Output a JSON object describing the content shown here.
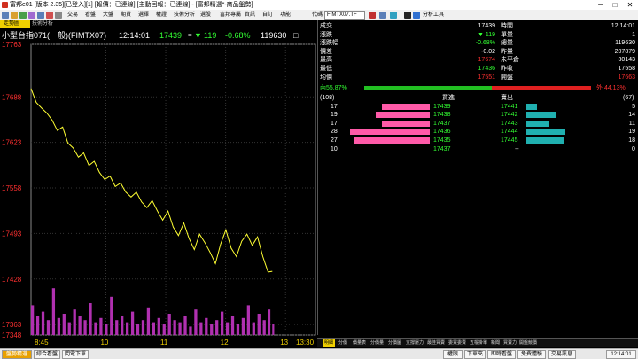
{
  "window": {
    "title": "富邦e01 [版本 2.35][已登入][1] [報價：已連線] [主動回報：已連線] - [富邦精選*-商品盤勢]",
    "min": "─",
    "max": "□",
    "close": "✕"
  },
  "menu": {
    "items": [
      "交易",
      "看盤",
      "大盤",
      "期貨",
      "選擇",
      "權證",
      "技術分析",
      "選股",
      "富邦專屬",
      "資訊",
      "自訂",
      "功能"
    ],
    "code_label": "代碼",
    "symbol": "FIMTX07.TF",
    "analysis": "分析工具"
  },
  "chart": {
    "tab_main": "走勢圖",
    "tab_tech": "技術分析",
    "product": "小型台指071(一般)(FIMTX07)",
    "time": "12:14:01",
    "last": "17439",
    "arrow": "▼",
    "change": "119",
    "pct": "-0.68%",
    "volume": "119630",
    "colors": {
      "price_line": "#ffff33",
      "volume": "#b030b0",
      "up": "#ff2020",
      "down": "#33ff33"
    }
  },
  "chart_data": {
    "type": "line",
    "y_ticks": [
      "17763",
      "17688",
      "17623",
      "17558",
      "17493",
      "17428",
      "17363",
      "17348"
    ],
    "x_ticks": [
      "8:45",
      "10",
      "11",
      "12",
      "13",
      "13:30"
    ],
    "ylim": [
      17348,
      17763
    ],
    "x": [
      0,
      5,
      10,
      15,
      20,
      25,
      30,
      35,
      40,
      45,
      50,
      55,
      60,
      65,
      70,
      75,
      80,
      85,
      90,
      95,
      100,
      105,
      110,
      115,
      120,
      125,
      130,
      135,
      140,
      145,
      150,
      155,
      160,
      165,
      170,
      175,
      180,
      185,
      190,
      195,
      200,
      205,
      210,
      215,
      220,
      225,
      229
    ],
    "values": [
      17700,
      17680,
      17672,
      17665,
      17655,
      17640,
      17645,
      17622,
      17615,
      17602,
      17608,
      17590,
      17596,
      17580,
      17570,
      17575,
      17560,
      17565,
      17552,
      17545,
      17552,
      17538,
      17530,
      17540,
      17525,
      17512,
      17525,
      17502,
      17490,
      17508,
      17486,
      17470,
      17492,
      17480,
      17466,
      17450,
      17478,
      17498,
      17472,
      17460,
      17482,
      17492,
      17476,
      17488,
      17460,
      17438,
      17439
    ],
    "volume_values": [
      14,
      9,
      11,
      7,
      22,
      8,
      10,
      6,
      12,
      9,
      7,
      15,
      6,
      8,
      5,
      18,
      7,
      9,
      6,
      11,
      5,
      7,
      13,
      6,
      8,
      5,
      10,
      7,
      6,
      9,
      4,
      12,
      6,
      8,
      5,
      7,
      11,
      6,
      9,
      5,
      8,
      14,
      6,
      10,
      7,
      12,
      5
    ]
  },
  "quote": {
    "left_labels": [
      "成交",
      "漲跌",
      "漲跌幅",
      "價差",
      "最高",
      "最低",
      "均價"
    ],
    "left_values": [
      "17439",
      "▼ 119",
      "-0.68%",
      "-0.02",
      "17674",
      "17436",
      "17551"
    ],
    "right_labels": [
      "時間",
      "單量",
      "總量",
      "昨量",
      "未平倉",
      "昨收",
      "開盤"
    ],
    "right_values": [
      "12:14:01",
      "1",
      "119630",
      "207879",
      "30143",
      "17558",
      "17663"
    ],
    "in_pct": "內55.87%",
    "out_pct": "外 44.13%",
    "bid_total": "(108)",
    "bid_header": "買進",
    "ask_header": "賣出",
    "ask_total": "(67)",
    "bids": [
      {
        "qty": "17",
        "price": "17439",
        "bar": 17
      },
      {
        "qty": "19",
        "price": "17438",
        "bar": 19
      },
      {
        "qty": "17",
        "price": "17437",
        "bar": 17
      },
      {
        "qty": "28",
        "price": "17436",
        "bar": 28
      },
      {
        "qty": "27",
        "price": "17435",
        "bar": 27
      }
    ],
    "asks": [
      {
        "price": "17441",
        "qty": "5",
        "bar": 5
      },
      {
        "price": "17442",
        "qty": "14",
        "bar": 14
      },
      {
        "price": "17443",
        "qty": "11",
        "bar": 11
      },
      {
        "price": "17444",
        "qty": "19",
        "bar": 19
      },
      {
        "price": "17445",
        "qty": "18",
        "bar": 18
      }
    ],
    "footer": {
      "left": "10",
      "mid": "17437",
      "dash": "--",
      "right": "0"
    }
  },
  "bottom_tabs": [
    "明細",
    "分價",
    "價量表",
    "分價量",
    "分價圖",
    "支撐壓力",
    "最佳買賣",
    "委買委賣",
    "五檔掛單",
    "新聞",
    "買賣力",
    "開盤競價"
  ],
  "status": {
    "items": [
      "盤勢精選",
      "綜合看盤",
      "閃電下單"
    ],
    "right": [
      "權限",
      "下單夾",
      "即時看盤",
      "免費體驗",
      "交易訊息"
    ],
    "clock": "12:14:01"
  }
}
